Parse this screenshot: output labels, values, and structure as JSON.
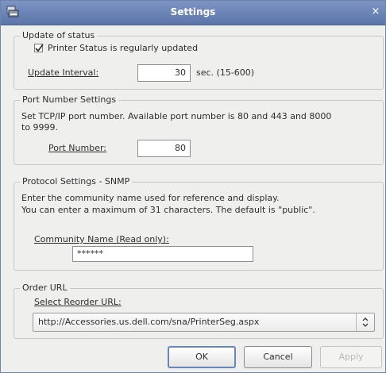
{
  "window": {
    "title": "Settings",
    "icon": "printer-settings-icon",
    "close_icon": "close-icon",
    "close_glyph": "×"
  },
  "status_group": {
    "legend": "Update of status",
    "checkbox_label": "Printer Status is regularly updated",
    "checked": true,
    "interval_label": "Update Interval:",
    "interval_value": "30",
    "interval_unit": "sec. (15-600)"
  },
  "port_group": {
    "legend": "Port Number Settings",
    "description_line1": "Set TCP/IP port number. Available port number is 80 and 443 and 8000",
    "description_line2": "to 9999.",
    "port_label": "Port Number:",
    "port_value": "80"
  },
  "snmp_group": {
    "legend": "Protocol Settings - SNMP",
    "description_line1": "Enter the community name used for reference and display.",
    "description_line2": "You can enter a maximum of 31 characters. The default is \"public\".",
    "community_label": "Community Name (Read only):",
    "community_value": "******"
  },
  "order_group": {
    "legend": "Order URL",
    "select_label": "Select Reorder URL:",
    "selected_url": "http://Accessories.us.dell.com/sna/PrinterSeg.aspx",
    "combo_icon": "up-down-arrows-icon"
  },
  "buttons": {
    "ok": "OK",
    "cancel": "Cancel",
    "apply": "Apply",
    "apply_enabled": false
  },
  "colors": {
    "titlebar": "#6c86b9",
    "window_bg": "#efefee",
    "default_button_border": "#6a86b8"
  }
}
